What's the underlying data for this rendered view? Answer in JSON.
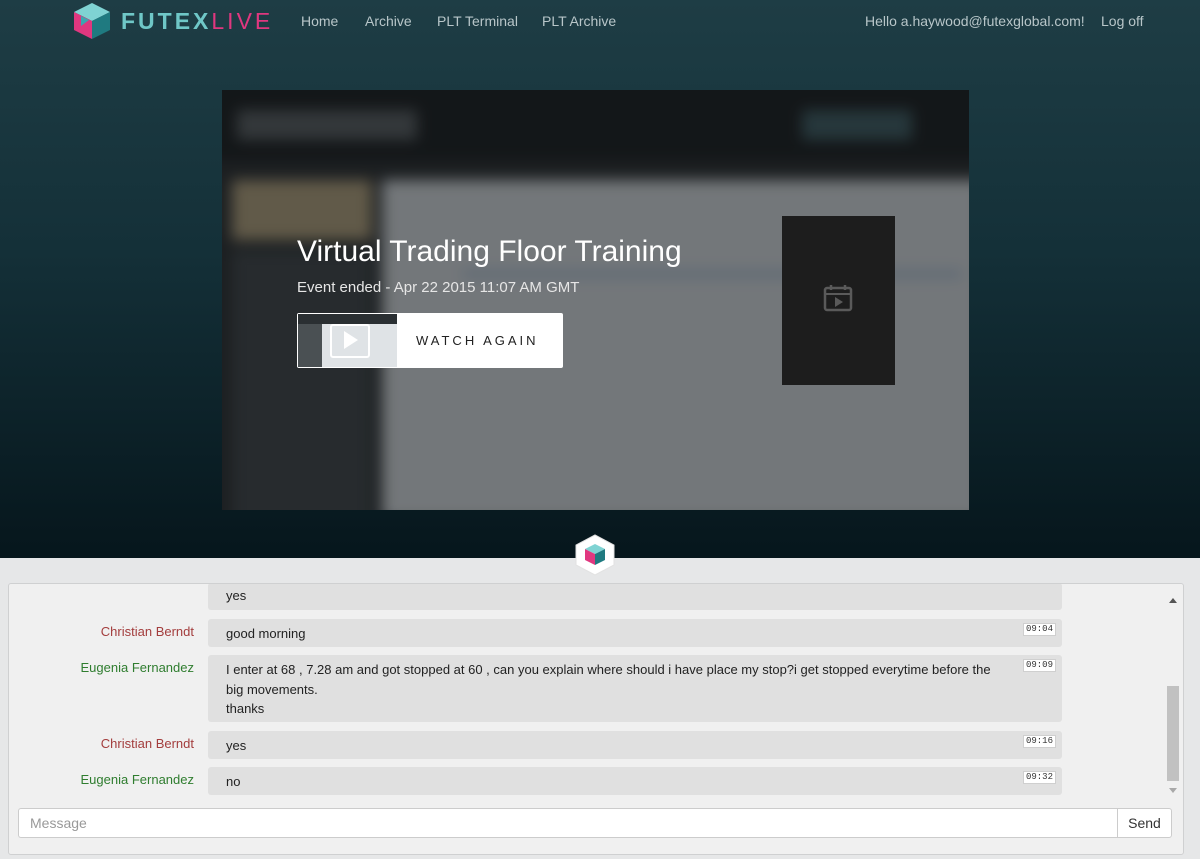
{
  "brand": {
    "name_part1": "FUTEX",
    "name_part2": "LIVE",
    "colors": {
      "teal": "#6fc7c7",
      "pink": "#e0377f",
      "dark_teal": "#1f7a80"
    }
  },
  "nav": {
    "items": [
      "Home",
      "Archive",
      "PLT Terminal",
      "PLT Archive"
    ],
    "greeting": "Hello a.haywood@futexglobal.com!",
    "logoff": "Log off"
  },
  "event": {
    "title": "Virtual Trading Floor Training",
    "status": "Event ended - Apr 22 2015 11:07 AM GMT",
    "watch_again": "WATCH AGAIN",
    "side_icon": "calendar-play-icon"
  },
  "chat": {
    "messages": [
      {
        "name": "",
        "text": "yes",
        "time": ""
      },
      {
        "name": "Christian Berndt",
        "text": "good morning",
        "time": "09:04",
        "color": "#a33d3d"
      },
      {
        "name": "Eugenia Fernandez",
        "lines": [
          "I enter at 68 , 7.28 am and got stopped at 60 , can you explain where should i have place my stop?i get stopped everytime before the",
          "big movements.",
          "thanks"
        ],
        "time": "09:09",
        "color": "#2f7d2f"
      },
      {
        "name": "Christian Berndt",
        "text": "yes",
        "time": "09:16",
        "color": "#a33d3d"
      },
      {
        "name": "Eugenia Fernandez",
        "text": "no",
        "time": "09:32",
        "color": "#2f7d2f"
      }
    ],
    "input_placeholder": "Message",
    "send_label": "Send"
  }
}
